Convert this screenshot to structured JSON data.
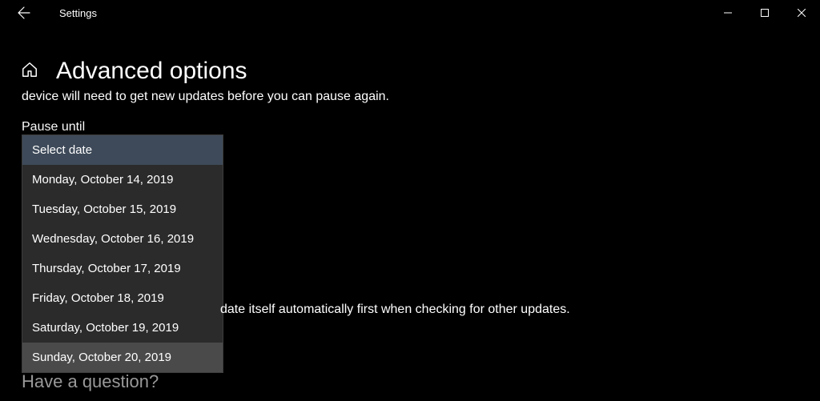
{
  "titlebar": {
    "app_title": "Settings"
  },
  "header": {
    "page_title": "Advanced options"
  },
  "body": {
    "truncated_device_text": "device will need to get new updates before you can pause again.",
    "pause_until_label": "Pause until",
    "update_text_partial": "date itself automatically first when checking for other updates.",
    "question_heading_partial": "Have a question?"
  },
  "dropdown": {
    "items": [
      {
        "label": "Select date",
        "selected": true,
        "hover": false
      },
      {
        "label": "Monday, October 14, 2019",
        "selected": false,
        "hover": false
      },
      {
        "label": "Tuesday, October 15, 2019",
        "selected": false,
        "hover": false
      },
      {
        "label": "Wednesday, October 16, 2019",
        "selected": false,
        "hover": false
      },
      {
        "label": "Thursday, October 17, 2019",
        "selected": false,
        "hover": false
      },
      {
        "label": "Friday, October 18, 2019",
        "selected": false,
        "hover": false
      },
      {
        "label": "Saturday, October 19, 2019",
        "selected": false,
        "hover": false
      },
      {
        "label": "Sunday, October 20, 2019",
        "selected": false,
        "hover": true
      }
    ]
  }
}
